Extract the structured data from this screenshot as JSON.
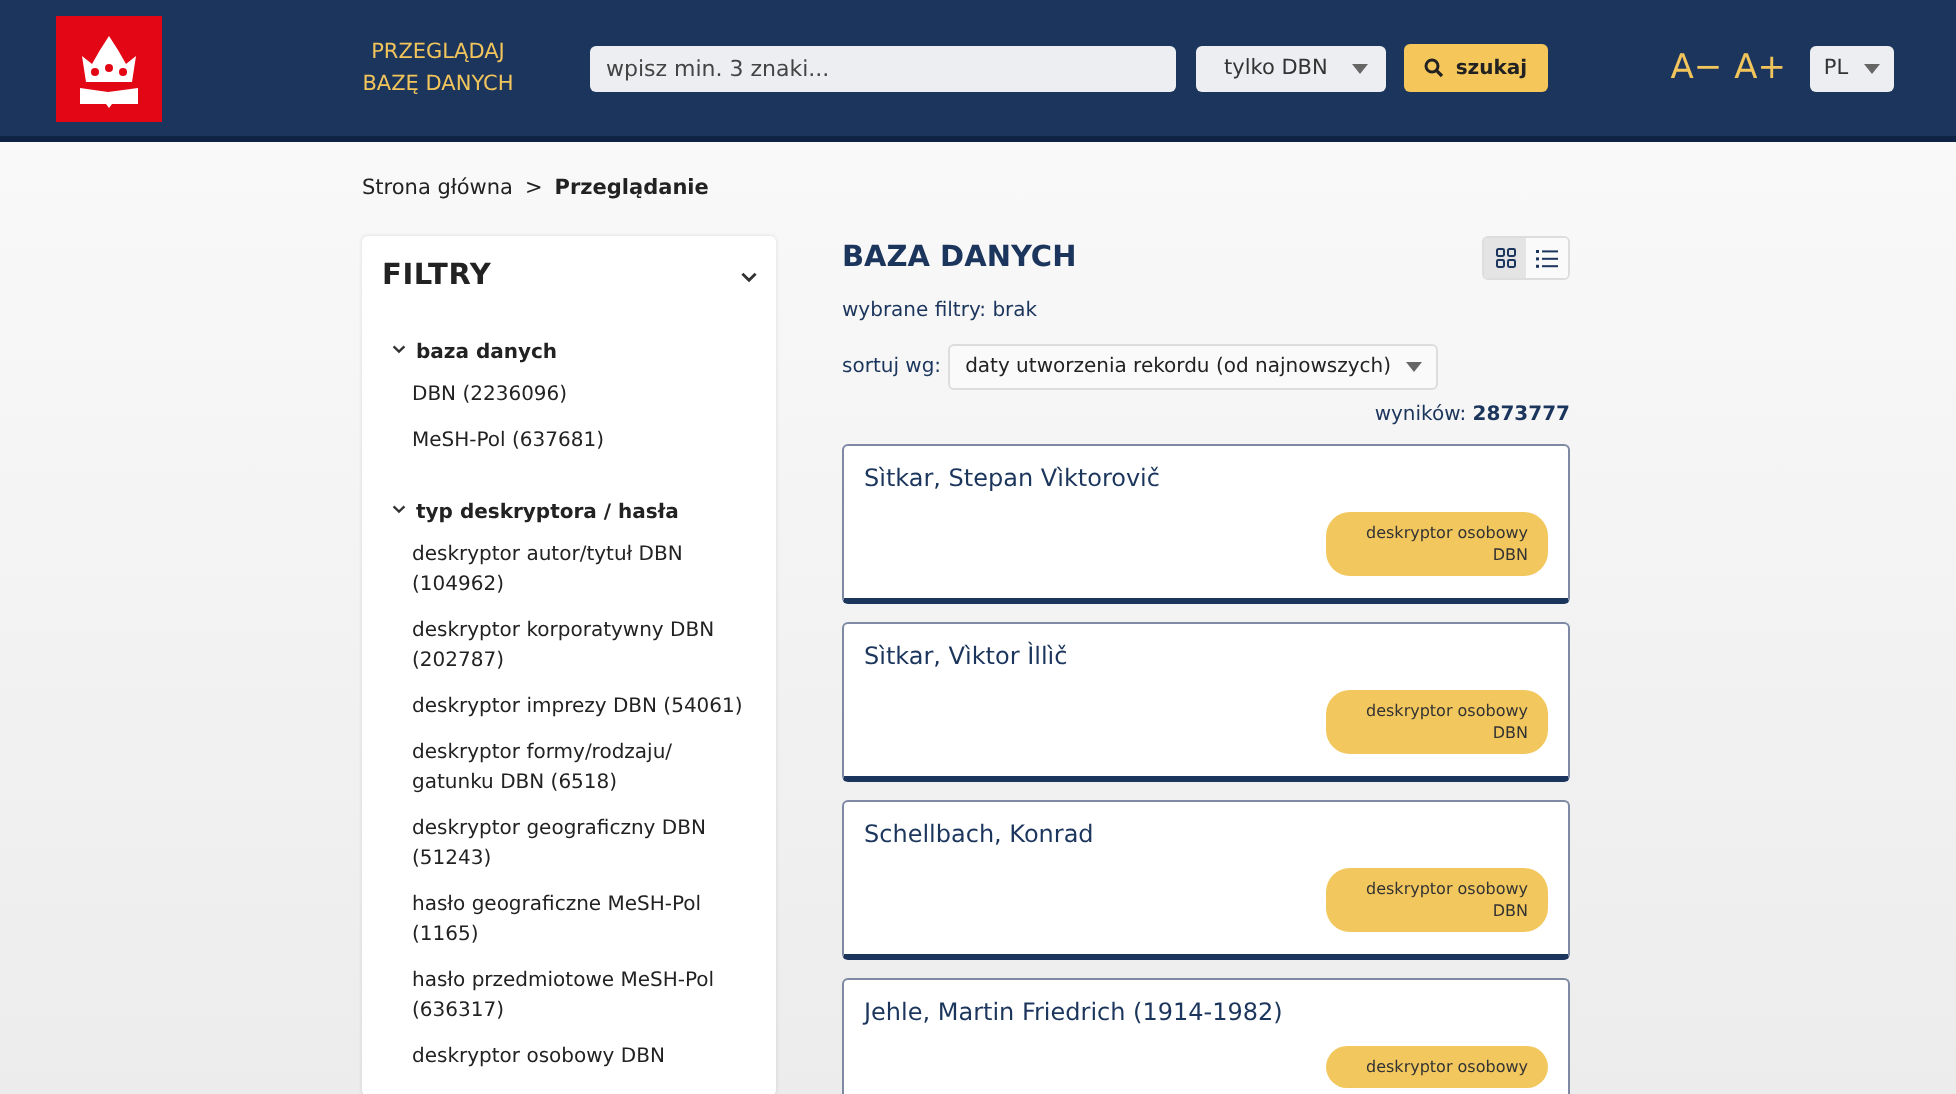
{
  "header": {
    "nav_link": "PRZEGLĄDAJ BAZĘ DANYCH",
    "search": {
      "placeholder": "wpisz min. 3 znaki..."
    },
    "scope_select": "tylko DBN",
    "search_button": "szukaj",
    "font_smaller": "A−",
    "font_larger": "A+",
    "language": "PL"
  },
  "breadcrumb": [
    {
      "label": "Strona główna",
      "current": false
    },
    {
      "label": "Przeglądanie",
      "current": true
    }
  ],
  "breadcrumb_separator": ">",
  "filters": {
    "title": "FILTRY",
    "expanded": true,
    "groups": [
      {
        "title": "baza danych",
        "expanded": true,
        "items": [
          "DBN (2236096)",
          "MeSH-Pol (637681)"
        ]
      },
      {
        "title": "typ deskryptora / hasła",
        "expanded": true,
        "items": [
          "deskryptor autor/tytuł DBN (104962)",
          "deskryptor korporatywny DBN (202787)",
          "deskryptor imprezy DBN (54061)",
          "deskryptor formy/rodzaju/ gatunku DBN (6518)",
          "deskryptor geograficzny DBN (51243)",
          "hasło geograficzne MeSH-Pol (1165)",
          "hasło przedmiotowe MeSH-Pol (636317)",
          "deskryptor osobowy DBN"
        ]
      }
    ]
  },
  "main": {
    "title": "BAZA DANYCH",
    "view_modes": [
      {
        "kind": "grid",
        "selected": true
      },
      {
        "kind": "list",
        "selected": false
      }
    ],
    "selected_filters": "wybrane filtry: brak",
    "sort_label": "sortuj wg:",
    "sort_value": "daty utworzenia rekordu (od najnowszych)",
    "results_label": "wyników:",
    "results_count": "2873777",
    "records": [
      {
        "name": "Sìtkar, Stepan Vìktorovič",
        "badge": "deskryptor osobowy DBN"
      },
      {
        "name": "Sìtkar, Vìktor Ìllìč",
        "badge": "deskryptor osobowy DBN"
      },
      {
        "name": "Schellbach, Konrad",
        "badge": "deskryptor osobowy DBN"
      },
      {
        "name": "Jehle, Martin Friedrich (1914-1982)",
        "badge": "deskryptor osobowy"
      }
    ]
  }
}
